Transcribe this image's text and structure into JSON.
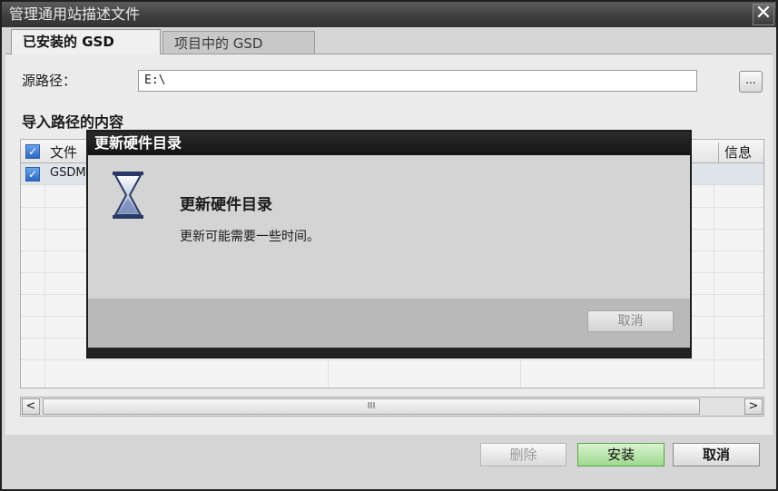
{
  "window": {
    "title": "管理通用站描述文件",
    "close_glyph": "✕"
  },
  "tabs": [
    {
      "label": "已安装的 GSD",
      "active": true
    },
    {
      "label": "项目中的 GSD",
      "active": false
    }
  ],
  "source": {
    "label": "源路径：",
    "value": "E:\\",
    "browse_label": "..."
  },
  "content": {
    "section_title": "导入路径的内容",
    "columns": [
      "文件",
      "信息"
    ],
    "rows": [
      {
        "file": "GSDM",
        "checked": true
      }
    ],
    "scroll_thumb_glyph": "III"
  },
  "footer": {
    "delete_label": "删除",
    "install_label": "安装",
    "cancel_label": "取消"
  },
  "modal": {
    "title": "更新硬件目录",
    "heading": "更新硬件目录",
    "message": "更新可能需要一些时间。",
    "cancel_label": "取消"
  },
  "colors": {
    "install_accent": "#9fd88f",
    "checkbox_blue": "#2b68c2",
    "titlebar": "#3d3d3d"
  }
}
